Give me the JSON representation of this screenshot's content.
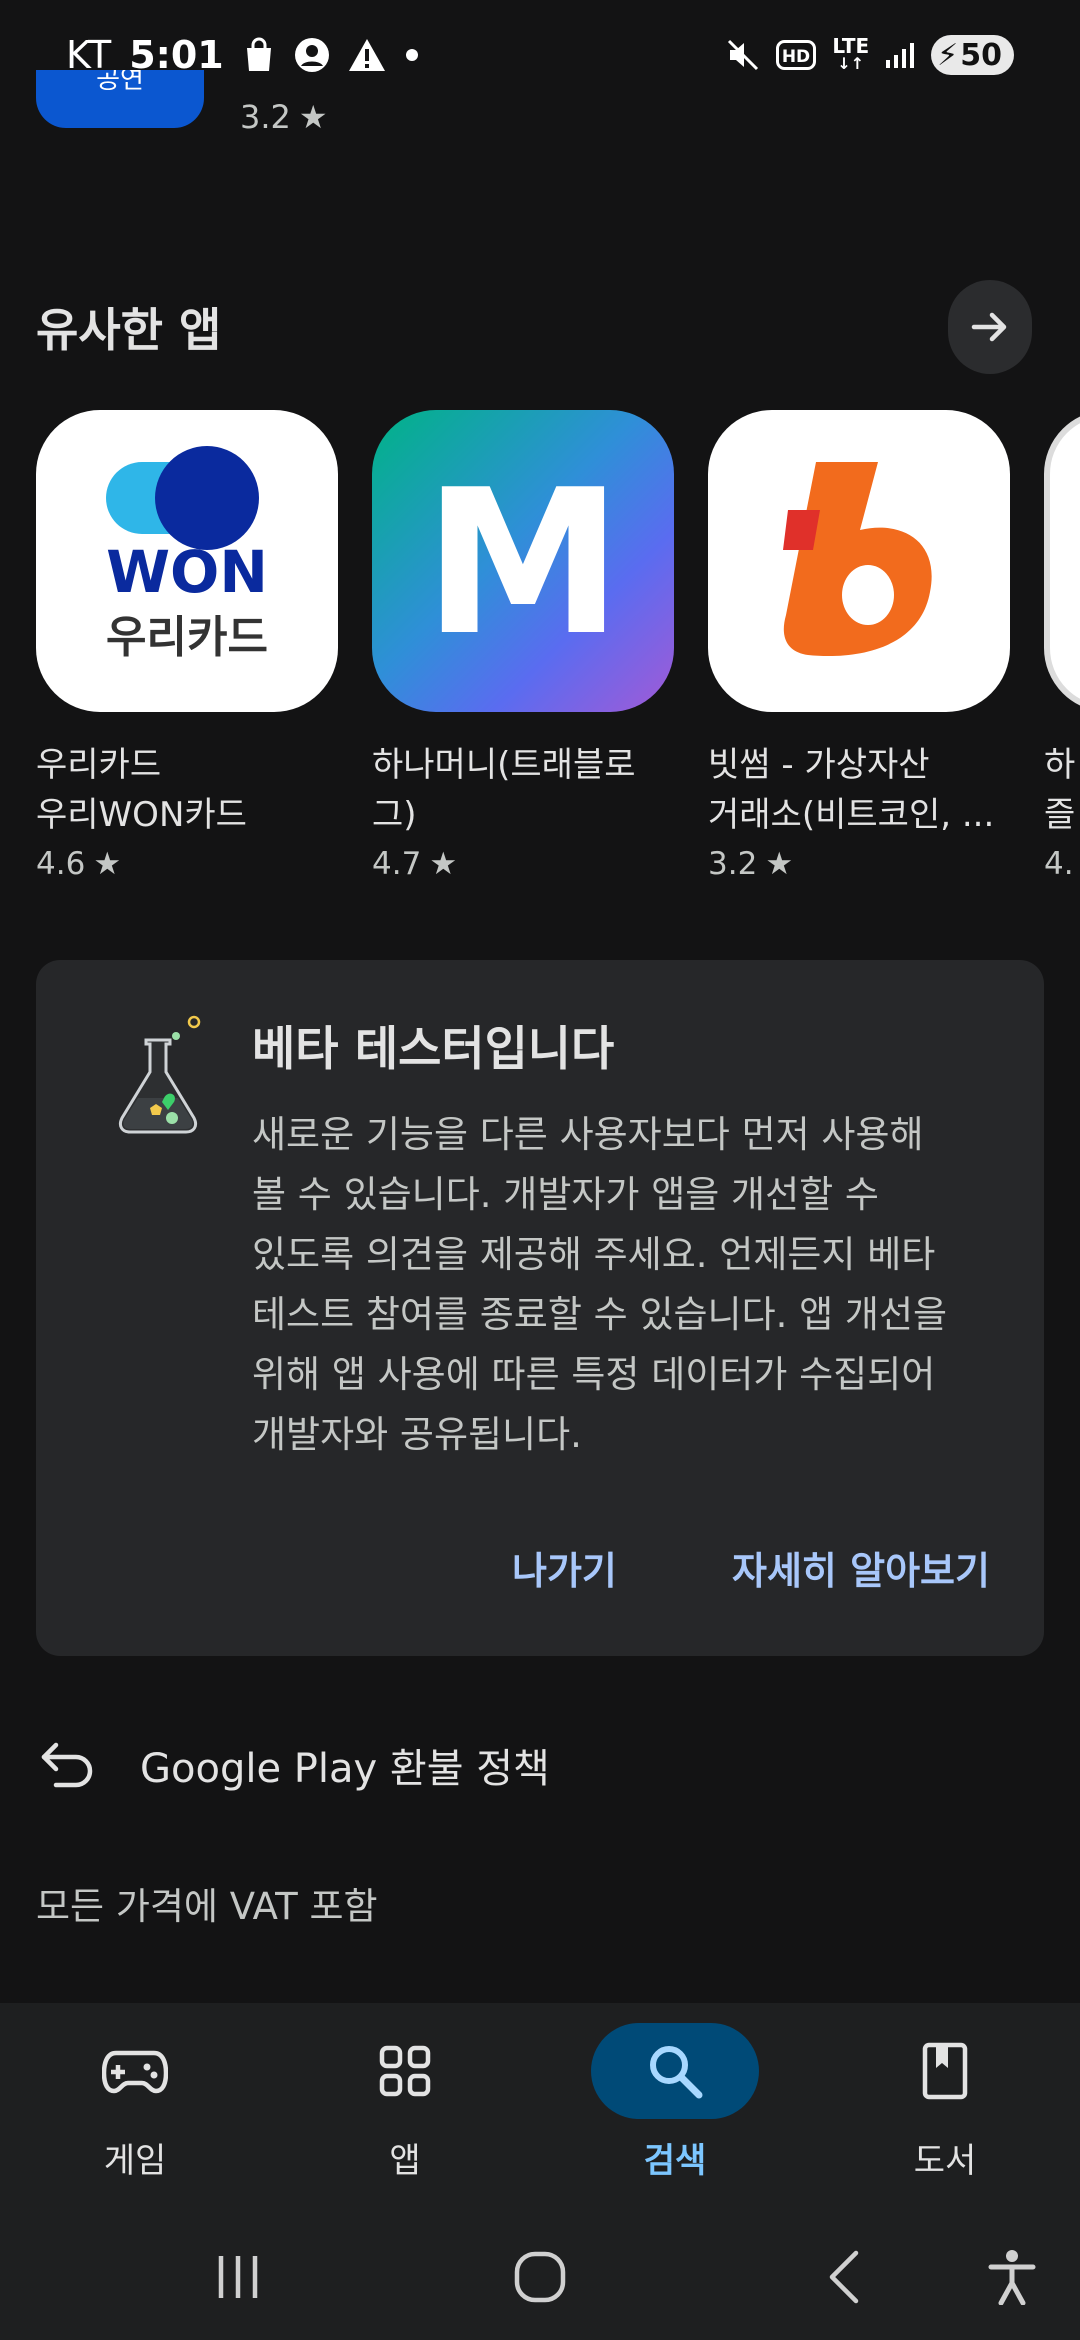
{
  "status_bar": {
    "carrier": "KT",
    "time": "5:01",
    "network": "LTE",
    "hd_label": "HD",
    "battery": "50"
  },
  "partial_item": {
    "button_label": "공연",
    "rating": "3.2"
  },
  "similar_apps": {
    "title": "유사한 앱",
    "apps": [
      {
        "name": "우리카드\n우리WON카드",
        "rating": "4.6",
        "icon_text_top": "WON",
        "icon_text_bottom": "우리카드",
        "icon": "woori-card-icon"
      },
      {
        "name": "하나머니(트래블로\n그)",
        "rating": "4.7",
        "icon_text": "M",
        "icon": "hana-money-icon"
      },
      {
        "name": "빗썸 - 가상자산\n거래소(비트코인, ...",
        "rating": "3.2",
        "icon": "bithumb-icon"
      },
      {
        "name": "하\n즐",
        "rating": "4.",
        "icon": "partial-app-icon"
      }
    ]
  },
  "beta_card": {
    "title": "베타 테스터입니다",
    "body": "새로운 기능을 다른 사용자보다 먼저 사용해\n볼 수 있습니다. 개발자가 앱을 개선할 수\n있도록 의견을 제공해 주세요. 언제든지 베타\n테스트 참여를 종료할 수 있습니다. 앱 개선을\n위해 앱 사용에 따른 특정 데이터가 수집되어\n개발자와 공유됩니다.",
    "leave_label": "나가기",
    "learn_more_label": "자세히 알아보기"
  },
  "refund": {
    "label": "Google Play 환불 정책"
  },
  "vat": {
    "label": "모든 가격에 VAT 포함"
  },
  "bottom_nav": {
    "items": [
      {
        "label": "게임",
        "icon": "gamepad-icon"
      },
      {
        "label": "앱",
        "icon": "apps-grid-icon"
      },
      {
        "label": "검색",
        "icon": "search-icon",
        "active": true
      },
      {
        "label": "도서",
        "icon": "book-icon"
      }
    ]
  },
  "colors": {
    "background": "#131314",
    "card": "#262729",
    "accent_link": "#a8c7fa",
    "active_nav": "#004a77"
  }
}
